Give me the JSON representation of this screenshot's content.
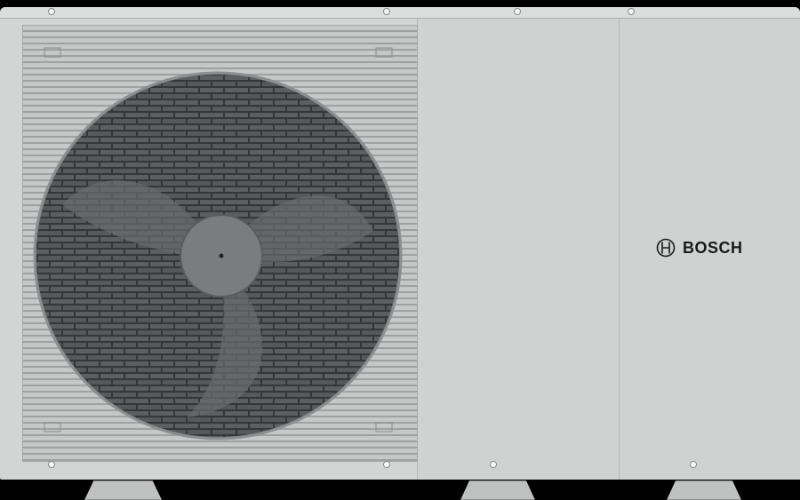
{
  "brand": {
    "logo_text": "BOSCH"
  },
  "colors": {
    "background": "#000000",
    "casing": "#d3d4d4",
    "fan": "#4a4b4c"
  }
}
